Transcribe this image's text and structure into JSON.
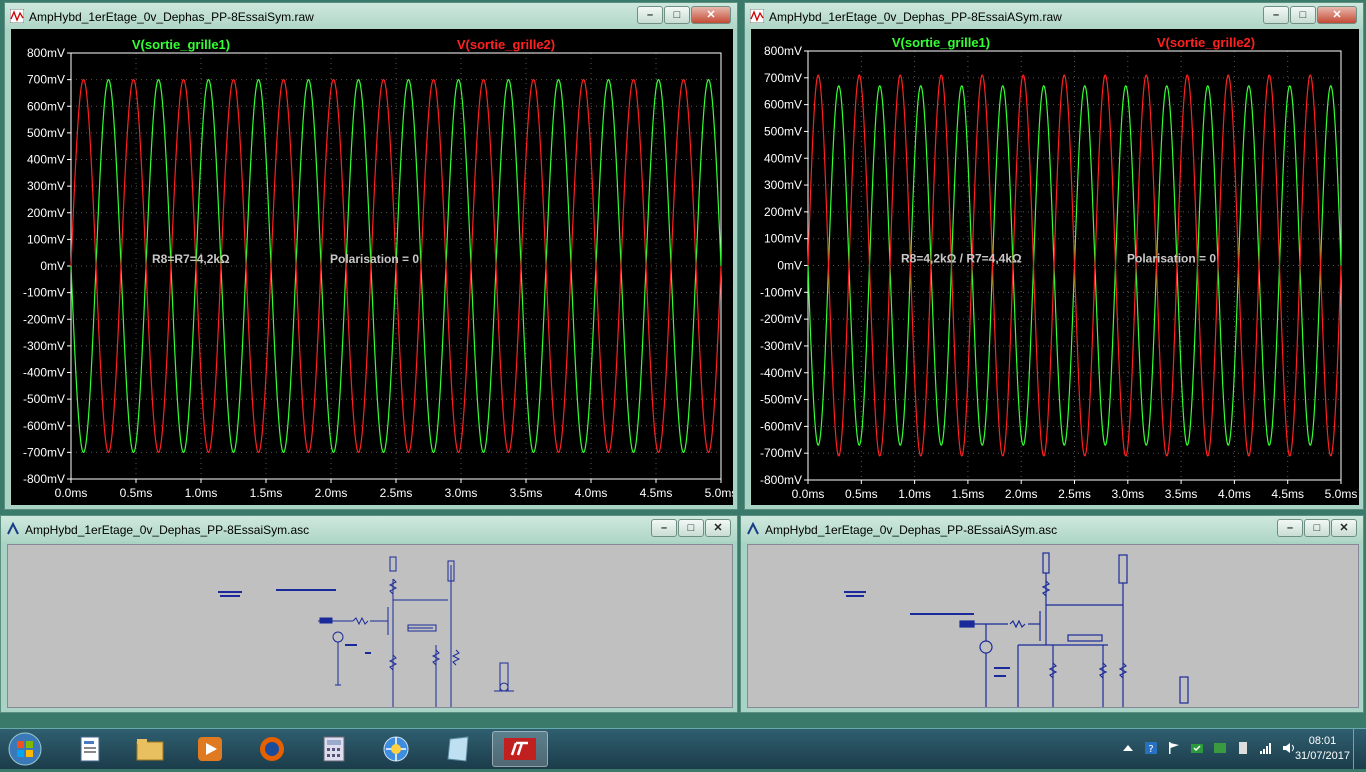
{
  "windows": {
    "plot_left": {
      "title": "AmpHybd_1erEtage_0v_Dephas_PP-8EssaiSym.raw",
      "trace1_label": "V(sortie_grille1)",
      "trace2_label": "V(sortie_grille2)",
      "annotation1": "R8=R7=4,2kΩ",
      "annotation2": "Polarisation = 0",
      "amp1": 0.7,
      "amp2": 0.7
    },
    "plot_right": {
      "title": "AmpHybd_1erEtage_0v_Dephas_PP-8EssaiASym.raw",
      "trace1_label": "V(sortie_grille1)",
      "trace2_label": "V(sortie_grille2)",
      "annotation1": "R8=4,2kΩ  /  R7=4,4kΩ",
      "annotation2": "Polarisation = 0",
      "amp1": 0.67,
      "amp2": 0.71
    },
    "sch_left": {
      "title": "AmpHybd_1erEtage_0v_Dephas_PP-8EssaiSym.asc"
    },
    "sch_right": {
      "title": "AmpHybd_1erEtage_0v_Dephas_PP-8EssaiASym.asc"
    }
  },
  "plot_common": {
    "y_ticks": [
      "800mV",
      "700mV",
      "600mV",
      "500mV",
      "400mV",
      "300mV",
      "200mV",
      "100mV",
      "0mV",
      "-100mV",
      "-200mV",
      "-300mV",
      "-400mV",
      "-500mV",
      "-600mV",
      "-700mV",
      "-800mV"
    ],
    "x_ticks": [
      "0.0ms",
      "0.5ms",
      "1.0ms",
      "1.5ms",
      "2.0ms",
      "2.5ms",
      "3.0ms",
      "3.5ms",
      "4.0ms",
      "4.5ms",
      "5.0ms"
    ],
    "x_range_ms": [
      0,
      5
    ],
    "y_range_v": [
      -0.8,
      0.8
    ],
    "frequency_khz": 2.6,
    "color_trace1": "#33ff33",
    "color_trace2": "#ff2020",
    "color_grid": "#555555"
  },
  "taskbar": {
    "time": "08:01",
    "date": "31/07/2017"
  },
  "icons": {
    "app": "ltspice-waveform-icon",
    "schematic": "ltspice-schematic-icon"
  }
}
